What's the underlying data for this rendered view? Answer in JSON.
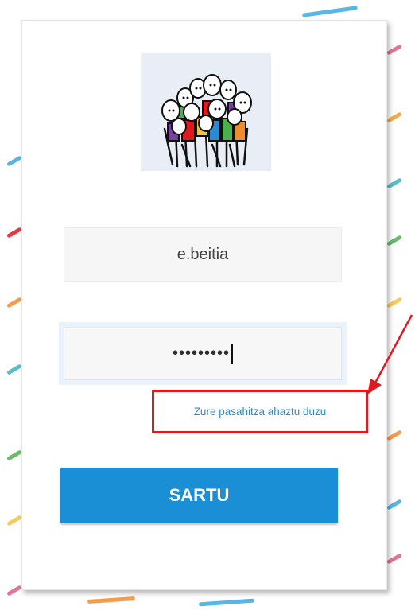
{
  "login": {
    "username_value": "e.beitia",
    "password_masked": "•••••••••",
    "forgot_password_link": "Zure pasahitza ahaztu duzu",
    "submit_label": "SARTU"
  },
  "logo": {
    "icon": "group-of-people-logo-icon"
  },
  "annotation": {
    "highlight_color": "#e0191f",
    "arrow_color": "#e0191f"
  },
  "colors": {
    "primary": "#1a8fd6",
    "link": "#2a8ad3"
  }
}
